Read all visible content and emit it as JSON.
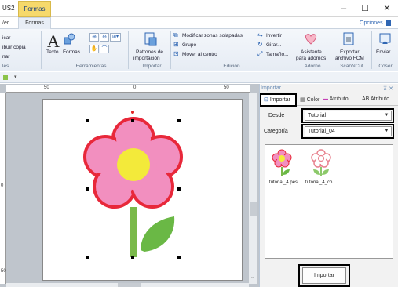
{
  "window": {
    "app_title": "US2",
    "active_top_tab": "Formas",
    "minimize": "–",
    "maximize": "☐",
    "close": "✕"
  },
  "ribbon_tabs": {
    "left_cut": "/er",
    "formas": "Formas",
    "opciones": "Opciones"
  },
  "ribbon": {
    "clipboard": {
      "item1": "icar",
      "item2": "ibuir copia",
      "item3": "nar",
      "group": "les"
    },
    "herramientas": {
      "texto": "Texto",
      "formas": "Formas",
      "group": "Herramientas"
    },
    "importar": {
      "patrones_line1": "Patrones de",
      "patrones_line2": "importación",
      "group": "Importar"
    },
    "edicion": {
      "modificar": "Modificar zonas solapadas",
      "grupo": "Grupo",
      "mover": "Mover al centro",
      "invertir": "Invertir",
      "girar": "Girar...",
      "tamano": "Tamaño...",
      "group": "Edición"
    },
    "adorno": {
      "asistente_line1": "Asistente",
      "asistente_line2": "para adornos",
      "group": "Adorno"
    },
    "scanncut": {
      "exportar_line1": "Exportar",
      "exportar_line2": "archivo FCM",
      "group": "ScanNCut"
    },
    "coser": {
      "enviar": "Enviar",
      "group": "Coser"
    }
  },
  "rulers": {
    "top_50": "50",
    "top_0": "0",
    "top_r50": "50",
    "left_0": "0",
    "left_50": "50"
  },
  "panel": {
    "title": "Importar",
    "pin": "⊼ ✕",
    "tabs": {
      "importar": "Importar",
      "color": "Color",
      "atributo1": "Atributo...",
      "atributo2": "AB Atributo..."
    },
    "desde_label": "Desde",
    "desde_value": "Tutorial",
    "categoria_label": "Categoría",
    "categoria_value": "Tutorial_04",
    "items": [
      {
        "label": "tutorial_4.pes"
      },
      {
        "label": "tutorial_4_co..."
      }
    ],
    "import_button": "Importar"
  },
  "colors": {
    "petal_fill": "#f28fbf",
    "petal_outline": "#e8283a",
    "center": "#f3ea3a",
    "stem": "#7ab94a",
    "leaf": "#6ab845"
  }
}
